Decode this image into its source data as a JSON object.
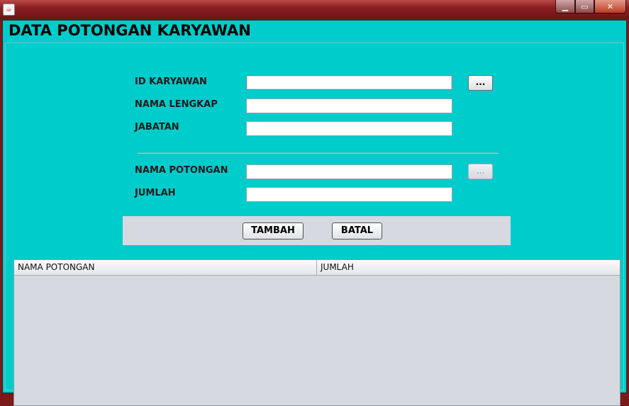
{
  "window": {
    "app_icon": "java-icon",
    "buttons": {
      "minimize": "▁",
      "maximize": "▭",
      "close": "✕"
    }
  },
  "page": {
    "title": "DATA POTONGAN KARYAWAN"
  },
  "form": {
    "id_karyawan": {
      "label": "ID KARYAWAN",
      "value": "",
      "lookup_label": "..."
    },
    "nama_lengkap": {
      "label": "NAMA LENGKAP",
      "value": ""
    },
    "jabatan": {
      "label": "JABATAN",
      "value": ""
    },
    "nama_potongan": {
      "label": "NAMA POTONGAN",
      "value": "",
      "lookup_label": "..."
    },
    "jumlah": {
      "label": "JUMLAH",
      "value": ""
    }
  },
  "actions": {
    "tambah": "TAMBAH",
    "batal": "BATAL"
  },
  "table": {
    "columns": [
      "NAMA POTONGAN",
      "JUMLAH"
    ],
    "rows": []
  },
  "colors": {
    "background": "#00cccc",
    "panel_bar": "#d6d9e0",
    "titlebar": "#8c1f22"
  }
}
